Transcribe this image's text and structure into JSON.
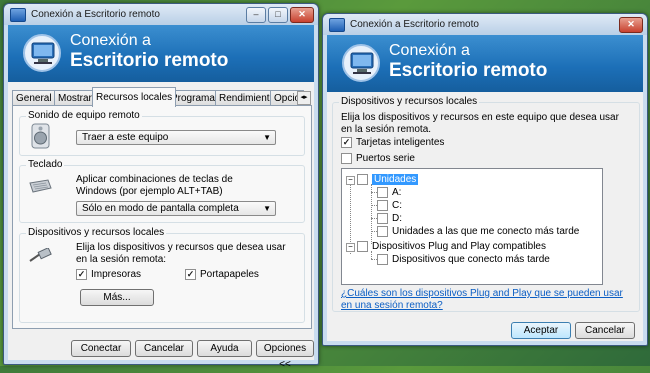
{
  "left_window": {
    "title": "Conexión a Escritorio remoto",
    "banner": {
      "line1": "Conexión a",
      "line2": "Escritorio remoto"
    },
    "tabs": [
      "General",
      "Mostrar",
      "Recursos locales",
      "Programas",
      "Rendimiento",
      "Opcio"
    ],
    "sound": {
      "label": "Sonido de equipo remoto",
      "selected": "Traer a este equipo"
    },
    "keyboard": {
      "label": "Teclado",
      "description": "Aplicar combinaciones de teclas de Windows (por ejemplo ALT+TAB)",
      "selected": "Sólo en modo de pantalla completa"
    },
    "devices": {
      "label": "Dispositivos y recursos locales",
      "description": "Elija los dispositivos y recursos que desea usar en la sesión remota:",
      "printers": "Impresoras",
      "clipboard": "Portapapeles",
      "more": "Más..."
    },
    "buttons": {
      "connect": "Conectar",
      "cancel": "Cancelar",
      "help": "Ayuda",
      "options": "Opciones <<"
    }
  },
  "right_window": {
    "title": "Conexión a Escritorio remoto",
    "banner": {
      "line1": "Conexión a",
      "line2": "Escritorio remoto"
    },
    "group_label": "Dispositivos y recursos locales",
    "description": "Elija los dispositivos y recursos en este equipo que desea usar en la sesión remota.",
    "smart_cards": "Tarjetas inteligentes",
    "serial_ports": "Puertos serie",
    "tree": {
      "drives": "Unidades",
      "drive_items": [
        "A:",
        "C:",
        "D:",
        "Unidades a las que me conecto más tarde"
      ],
      "pnp": "Dispositivos Plug and Play compatibles",
      "pnp_items": [
        "Dispositivos que conecto más tarde"
      ]
    },
    "help_link": "¿Cuáles son los dispositivos Plug and Play que se pueden usar en una sesión remota?",
    "buttons": {
      "accept": "Aceptar",
      "cancel": "Cancelar"
    }
  }
}
